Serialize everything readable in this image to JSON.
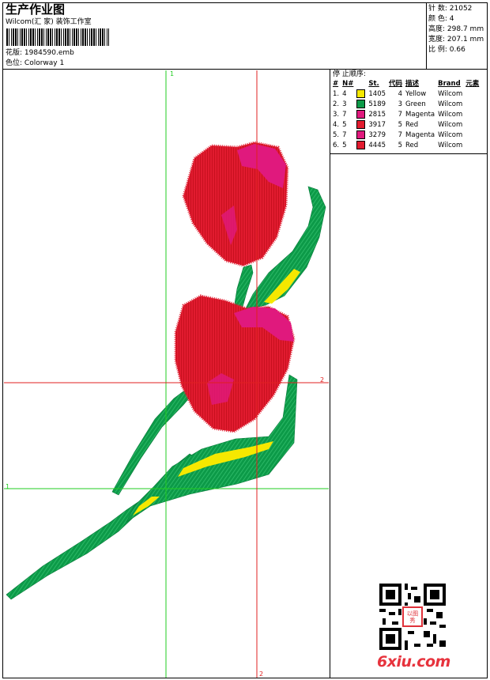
{
  "header": {
    "title": "生产作业图",
    "company": "Wilcom(汇 家) 装饰工作室",
    "design_label": "花版:",
    "design_file": "1984590.emb",
    "colorway_label": "色位:",
    "colorway": "Colorway 1"
  },
  "stats": {
    "stitches_label": "针 数:",
    "stitches": "21052",
    "colors_label": "颜 色:",
    "colors": "4",
    "height_label": "高度:",
    "height": "298.7 mm",
    "width_label": "宽度:",
    "width": "207.1 mm",
    "scale_label": "比 例:",
    "scale": "0.66"
  },
  "stop_sequence": {
    "title": "停 止顺序:",
    "columns": [
      "#",
      "N#",
      "St.",
      "代码",
      "描述",
      "Brand",
      "元素"
    ],
    "rows": [
      {
        "idx": "1.",
        "needle": "4",
        "code": "1405",
        "st": "4",
        "desc": "Yellow",
        "brand": "Wilcom",
        "color": "#f5e800"
      },
      {
        "idx": "2.",
        "needle": "3",
        "code": "5189",
        "st": "3",
        "desc": "Green",
        "brand": "Wilcom",
        "color": "#0c9a48"
      },
      {
        "idx": "3.",
        "needle": "7",
        "code": "2815",
        "st": "7",
        "desc": "Magenta",
        "brand": "Wilcom",
        "color": "#e0197d"
      },
      {
        "idx": "4.",
        "needle": "5",
        "code": "3917",
        "st": "5",
        "desc": "Red",
        "brand": "Wilcom",
        "color": "#e11b2f"
      },
      {
        "idx": "5.",
        "needle": "7",
        "code": "3279",
        "st": "7",
        "desc": "Magenta",
        "brand": "Wilcom",
        "color": "#e0197d"
      },
      {
        "idx": "6.",
        "needle": "5",
        "code": "4445",
        "st": "5",
        "desc": "Red",
        "brand": "Wilcom",
        "color": "#e11b2f"
      }
    ]
  },
  "guides": {
    "green_top": "1",
    "green_left": "1",
    "red_right": "2",
    "red_bottom": "2"
  },
  "watermark": {
    "site": "6xiu.com",
    "seal_text": "以图 秀"
  },
  "colors": {
    "guide_green": "#22cc22",
    "guide_red": "#e02020",
    "leaf_green": "#0c9a48",
    "petal_red": "#e11b2f",
    "petal_magenta": "#e0197d",
    "accent_yellow": "#f5e800"
  }
}
